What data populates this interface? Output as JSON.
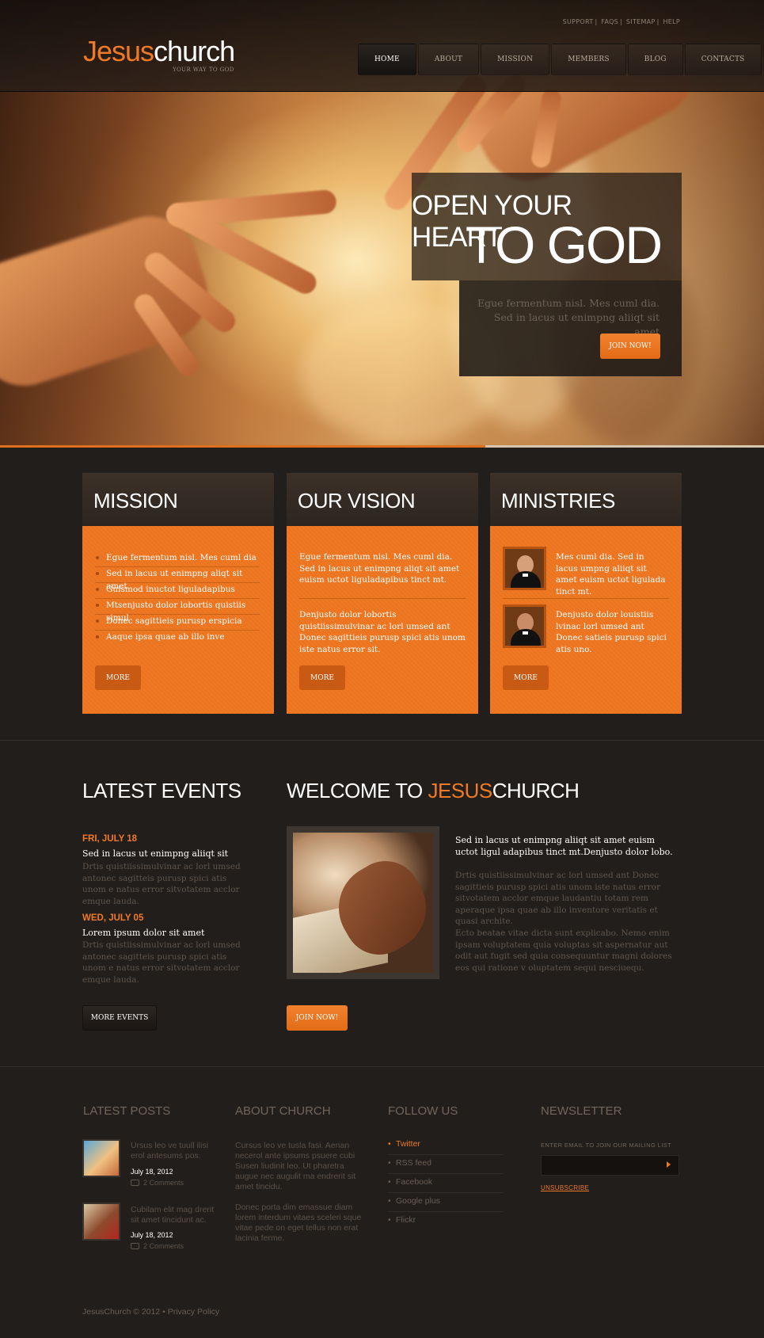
{
  "header": {
    "top_links": [
      "SUPPORT",
      "FAQS",
      "SITEMAP",
      "HELP"
    ],
    "logo_part1": "Jesus",
    "logo_part2": "church",
    "tagline": "YOUR WAY TO GOD",
    "nav": [
      {
        "label": "HOME",
        "active": true
      },
      {
        "label": "ABOUT"
      },
      {
        "label": "MISSION"
      },
      {
        "label": "MEMBERS"
      },
      {
        "label": "BLOG"
      },
      {
        "label": "CONTACTS"
      }
    ]
  },
  "hero": {
    "heading_line1": "OPEN YOUR HEART",
    "heading_line2": "TO GOD",
    "subtext": "Egue fermentum nisl. Mes cuml dia. Sed in lacus ut enimpng aliiqt sit amet",
    "button": "JOIN NOW!"
  },
  "boxes": {
    "mission": {
      "title": "MISSION",
      "items": [
        "Egue fermentum nisl. Mes cuml dia",
        "Sed in lacus ut enimpng aliqt sit amet",
        "Guismod inuctot liguladapibus",
        "Mtsenjusto dolor lobortis quistiis simul",
        "Donec sagittieis purusp erspicia",
        "Aaque ipsa quae ab illo inve"
      ],
      "button": "MORE"
    },
    "vision": {
      "title": "OUR VISION",
      "para1": "Egue fermentum nisl. Mes cuml dia. Sed in lacus ut enimpng aliqt sit amet euism uctot liguladapibus tinct mt.",
      "para2": "Denjusto dolor lobortis quistiissimulvinar ac lorl umsed ant Donec sagittieis purusp spici atis unom iste natus error sit.",
      "button": "MORE"
    },
    "ministries": {
      "title": "MINISTRIES",
      "item1": "Mes cuml dia. Sed in lacus umpng aliiqt sit amet euism uctot ligulada tinct mt.",
      "item2": "Denjusto dolor louistiis lvinac lorl umsed ant Donec satieis purusp spici atis uno.",
      "button": "MORE"
    }
  },
  "events": {
    "title": "LATEST EVENTS",
    "items": [
      {
        "date": "FRI, JULY 18",
        "title": "Sed in lacus ut enimpng aliiqt sit",
        "text": "Drtis quistiissimulvinar ac lorl umsed antonec sagitteis purusp spici atis unom e natus error sitvotatem acclor emque lauda."
      },
      {
        "date": "WED, JULY 05",
        "title": "Lorem ipsum dolor sit amet",
        "text": "Drtis quistiissimulvinar ac lorl umsed antonec sagitteis purusp spici atis unom e natus error sitvotatem acclor emque lauda."
      }
    ],
    "button": "MORE EVENTS"
  },
  "welcome": {
    "title_prefix": "WELCOME TO ",
    "title_accent": "JESUS",
    "title_suffix": "CHURCH",
    "lead": "Sed in lacus ut enimpng aliiqt sit amet euism uctot ligul adapibus tinct mt.Denjusto dolor lobo.",
    "para1": "Drtis quistiissimulvinar ac lorl umsed ant Donec sagittieis purusp spici atis unom iste natus error sitvotatem acclor emque laudantiu totam rem aperaque ipsa quae ab illo inventore veritatis et quasi archite.",
    "para2": "Ecto beatae vitae dicta sunt explicabo. Nemo enim ipsam voluptatem quia voluptas sit aspernatur aut odit aut fugit sed quia consequuntur magni dolores eos qui ratione v oluptatem sequi nesciuequ.",
    "button": "JOIN NOW!"
  },
  "footer": {
    "latest_posts": {
      "title": "LATEST POSTS",
      "posts": [
        {
          "text": "Ursus leo ve tuull ilisi erol antesums pos.",
          "date": "July 18, 2012",
          "comments": "2 Comments"
        },
        {
          "text": "Cubilam elit mag drerit sit amet tincidunt ac.",
          "date": "July 18, 2012",
          "comments": "2 Comments"
        }
      ]
    },
    "about": {
      "title": "ABOUT CHURCH",
      "para1": "Cursus leo ve tusla fasi. Aenan necerol ante ipsums psuere cubi Susen liudinit leo. Ut pharetra augue nec augulit ma endrerit sit amet tincidu.",
      "para2": "Donec porta dim emassue diam lorem interdum vitaes sceleri sque vitae pede on eget tellus non erat lacinia ferme."
    },
    "follow": {
      "title": "FOLLOW  US",
      "items": [
        "Twitter",
        "RSS feed",
        "Facebook",
        "Google plus",
        "Flickr"
      ]
    },
    "newsletter": {
      "title": "NEWSLETTER",
      "label": "ENTER EMAIL TO JOIN OUR MAILING LIST",
      "input_value": "",
      "unsubscribe": "UNSUBSCRIBE"
    },
    "copyright": "JesusChurch © 2012 • Privacy Policy"
  }
}
